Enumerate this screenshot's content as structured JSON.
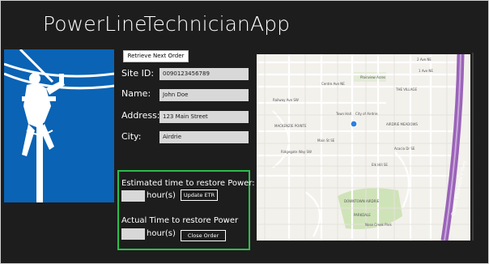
{
  "app": {
    "title": "PowerLineTechnicianApp"
  },
  "order": {
    "retrieve_label": "Retrieve Next Order",
    "site_id_label": "Site ID:",
    "site_id_value": "0090123456789",
    "name_label": "Name:",
    "name_value": "John Doe",
    "address_label": "Address:",
    "address_value": "123 Main Street",
    "city_label": "City:",
    "city_value": "Airdrie"
  },
  "restore": {
    "estimated_label": "Estimated time to restore Power:",
    "estimated_units": "hour(s)",
    "update_label": "Update ETR",
    "actual_label": "Actual Time to restore Power",
    "actual_units": "hour(s)",
    "close_label": "Close Order"
  },
  "map": {
    "labels": {
      "ave_2": "2 Ave NE",
      "ave_1": "1 Ave NE",
      "centre_ave": "Centre Ave NE",
      "railway": "Railway Ave SW",
      "plainview": "Plainview Acres",
      "village": "THE VILLAGE",
      "town_hall": "Town Hall",
      "city_of_airdrie": "City of Airdrie",
      "mackenzie": "MACKENZIE POINTE",
      "airdrie_meadows": "AIRDRIE MEADOWS",
      "main_st": "Main St SE",
      "acacia": "Acacia Dr SE",
      "ridgegate": "Ridgegate Way SW",
      "elk_hill": "Elk Hill SE",
      "downtown": "DOWNTOWN AIRDRIE",
      "parkdale": "PARKDALE",
      "nose_creek": "Nose Creek Park",
      "highway": "Queen Elizabeth II Hwy"
    }
  },
  "colors": {
    "background": "#1d1d1d",
    "accent_green": "#2dbd4a",
    "logo_blue": "#0a63b4",
    "highway_purple": "#9a63b8"
  },
  "icons": {
    "logo": "lineman-on-pole-icon",
    "location_pin": "location-dot-icon"
  }
}
